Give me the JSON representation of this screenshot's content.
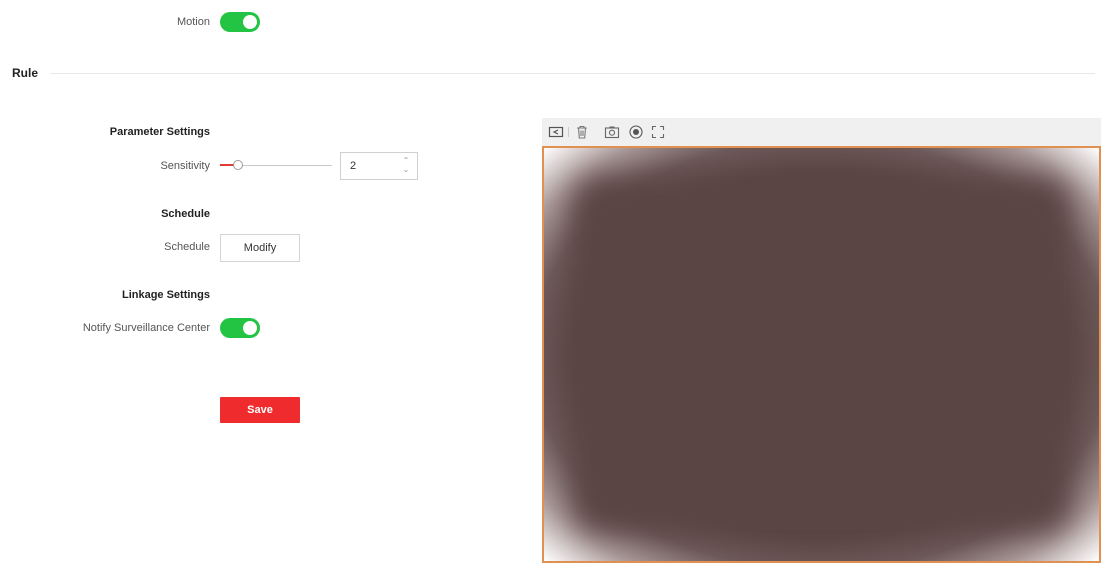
{
  "motion": {
    "label": "Motion",
    "enabled": true
  },
  "rule": {
    "title": "Rule"
  },
  "parameter_settings": {
    "title": "Parameter Settings",
    "sensitivity_label": "Sensitivity",
    "sensitivity_value": "2"
  },
  "schedule": {
    "title": "Schedule",
    "label": "Schedule",
    "modify_label": "Modify"
  },
  "linkage_settings": {
    "title": "Linkage Settings",
    "notify_label": "Notify Surveillance Center",
    "notify_enabled": true
  },
  "actions": {
    "save_label": "Save"
  },
  "video_toolbar": {
    "icons": [
      "draw-area-icon",
      "delete-icon",
      "capture-icon",
      "record-icon",
      "fullscreen-icon"
    ]
  },
  "colors": {
    "toggle_on": "#23c343",
    "save_button": "#ef2b2d",
    "slider_fill": "#e53935",
    "video_border": "#e09050",
    "video_fill": "#5b4444"
  }
}
